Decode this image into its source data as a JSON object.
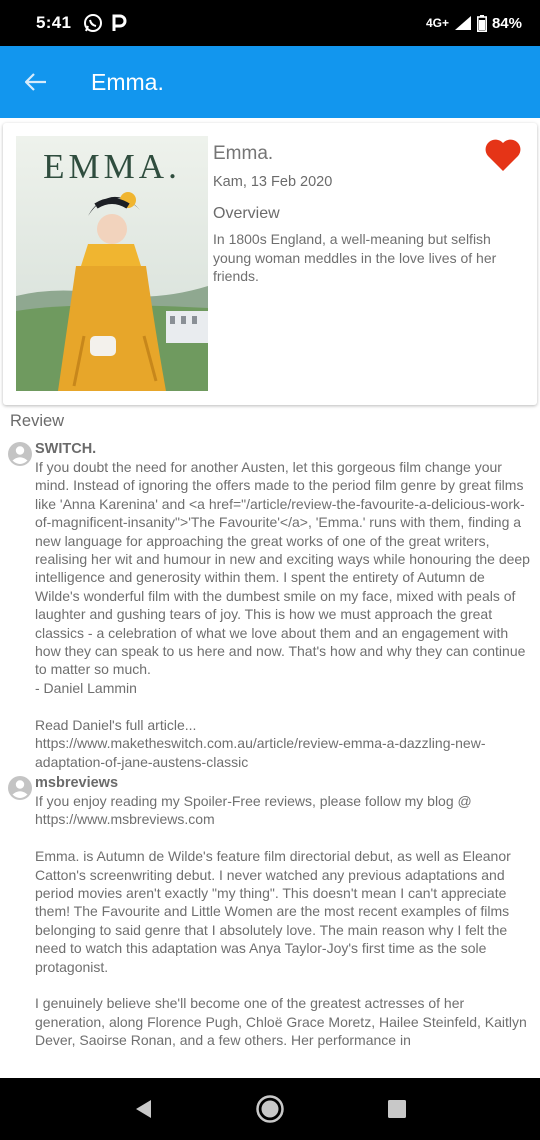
{
  "status_bar": {
    "time": "5:41",
    "network": "4G+",
    "battery": "84%",
    "icons": [
      "whatsapp-icon",
      "p-app-icon",
      "signal-icon",
      "battery-icon"
    ]
  },
  "app_bar": {
    "title": "Emma.",
    "color": "#1296ee"
  },
  "movie": {
    "title": "Emma.",
    "date": "Kam, 13 Feb 2020",
    "overview_label": "Overview",
    "overview": "In 1800s England, a well-meaning but selfish young woman meddles in the love lives of her friends.",
    "poster_title": "EMMA.",
    "favorite": true,
    "favorite_color": "#e53417"
  },
  "review_section": {
    "label": "Review"
  },
  "reviews": [
    {
      "author": "SWITCH.",
      "content": "If you doubt the need for another Austen, let this gorgeous film change your mind. Instead of ignoring the offers made to the period film genre by great films like 'Anna Karenina' and <a href=\"/article/review-the-favourite-a-delicious-work-of-magnificent-insanity\">'The Favourite'</a>, 'Emma.' runs with them, finding a new language for approaching the great works of one of the great writers, realising her wit and humour in new and exciting ways while honouring the deep intelligence and generosity within them. I spent the entirety of Autumn de Wilde's wonderful film with the dumbest smile on my face, mixed with peals of laughter and gushing tears of joy. This is how we must approach the great classics - a celebration of what we love about them and an engagement with how they can speak to us here and now. That's how and why they can continue to matter so much.\n- Daniel Lammin\n\nRead Daniel's full article...\nhttps://www.maketheswitch.com.au/article/review-emma-a-dazzling-new-adaptation-of-jane-austens-classic"
    },
    {
      "author": "msbreviews",
      "content": "If you enjoy reading my Spoiler-Free reviews, please follow my blog @ https://www.msbreviews.com\n\nEmma. is Autumn de Wilde's feature film directorial debut, as well as Eleanor Catton's screenwriting debut. I never watched any previous adaptations and period movies aren't exactly \"my thing\". This doesn't mean I can't appreciate them! The Favourite and Little Women are the most recent examples of films belonging to said genre that I absolutely love. The main reason why I felt the need to watch this adaptation was Anya Taylor-Joy's first time as the sole protagonist.\n\nI genuinely believe she'll become one of the greatest actresses of her generation, along Florence Pugh, Chloë Grace Moretz, Hailee Steinfeld, Kaitlyn Dever, Saoirse Ronan, and a few others. Her performance in"
    }
  ],
  "nav_bar": {
    "buttons": [
      "back-triangle-icon",
      "home-circle-icon",
      "recents-square-icon"
    ]
  }
}
